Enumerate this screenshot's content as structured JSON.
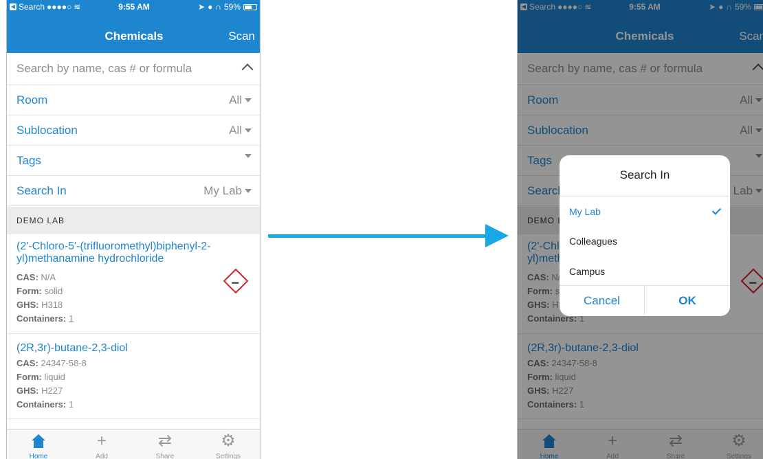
{
  "status_bar": {
    "back_app": "Search",
    "signal": "●●●●○",
    "time": "9:55 AM",
    "battery": "59%"
  },
  "nav": {
    "title": "Chemicals",
    "scan_label": "Scan"
  },
  "search": {
    "placeholder": "Search by name, cas # or formula"
  },
  "filters": [
    {
      "label": "Room",
      "value": "All"
    },
    {
      "label": "Sublocation",
      "value": "All"
    },
    {
      "label": "Tags",
      "value": ""
    },
    {
      "label": "Search In",
      "value": "My Lab"
    }
  ],
  "section_title": "DEMO LAB",
  "items": [
    {
      "name": "(2'-Chloro-5'-(trifluoromethyl)biphenyl-2-yl)methanamine hydrochloride",
      "cas_label": "CAS:",
      "cas": "N/A",
      "form_label": "Form:",
      "form": "solid",
      "ghs_label": "GHS:",
      "ghs": "H318",
      "containers_label": "Containers:",
      "containers": "1",
      "pictogram": "corrosion-pictogram-icon"
    },
    {
      "name": "(2R,3r)-butane-2,3-diol",
      "cas_label": "CAS:",
      "cas": "24347-58-8",
      "form_label": "Form:",
      "form": "liquid",
      "ghs_label": "GHS:",
      "ghs": "H227",
      "containers_label": "Containers:",
      "containers": "1"
    }
  ],
  "tabs": [
    {
      "label": "Home",
      "icon": "home-icon",
      "active": true
    },
    {
      "label": "Add",
      "icon": "plus-icon"
    },
    {
      "label": "Share",
      "icon": "swap-arrows-icon"
    },
    {
      "label": "Settings",
      "icon": "gear-icon"
    }
  ],
  "dialog": {
    "title": "Search In",
    "options": [
      {
        "label": "My Lab",
        "selected": true
      },
      {
        "label": "Colleagues"
      },
      {
        "label": "Campus"
      }
    ],
    "cancel_label": "Cancel",
    "ok_label": "OK"
  },
  "colors": {
    "brand_blue": "#1e86cf",
    "arrow_blue": "#1aa7e6",
    "hazard_red": "#d8222a"
  }
}
